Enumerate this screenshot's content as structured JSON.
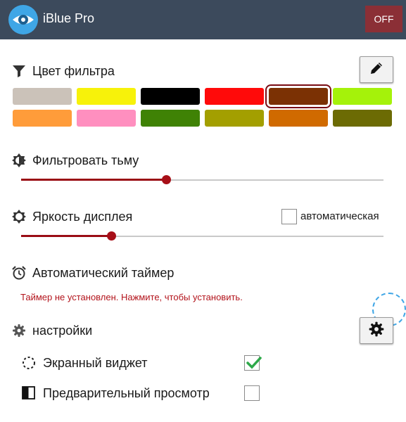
{
  "header": {
    "app_title": "iBlue Pro",
    "power_label": "OFF"
  },
  "filter_color": {
    "title": "Цвет фильтра",
    "icon": "funnel-icon",
    "edit_icon": "pencil-icon",
    "selected": "#7b3104",
    "swatches": [
      "#cbc2b9",
      "#f7f20a",
      "#000000",
      "#ff0a0a",
      "#7b3104",
      "#a5f20a",
      "#ff9c3a",
      "#ff8fbf",
      "#3f8205",
      "#a39f00",
      "#d06a00",
      "#6c6b04"
    ]
  },
  "dim_filter": {
    "title": "Фильтровать тьму",
    "icon": "brightness-half-icon",
    "level_percent": 40
  },
  "display_brightness": {
    "title": "Яркость дисплея",
    "icon": "brightness-outline-icon",
    "level_percent": 25,
    "auto_label": "автоматическая",
    "auto_checked": false
  },
  "timer": {
    "title": "Автоматический таймер",
    "icon": "alarm-clock-icon",
    "status_text": "Таймер не установлен. Нажмите, чтобы установить."
  },
  "settings": {
    "title": "настройки",
    "icon": "gear-icon",
    "button_icon": "gear-icon",
    "options": [
      {
        "label": "Экранный виджет",
        "icon": "dotted-circle-icon",
        "checked": true
      },
      {
        "label": "Предварительный просмотр",
        "icon": "half-square-icon",
        "checked": false
      }
    ]
  },
  "colors": {
    "titlebar": "#3c4a5c",
    "accent": "#a70f18",
    "power_button": "#8b2f36",
    "logo": "#3fa6e6",
    "check": "#2ea84a"
  }
}
